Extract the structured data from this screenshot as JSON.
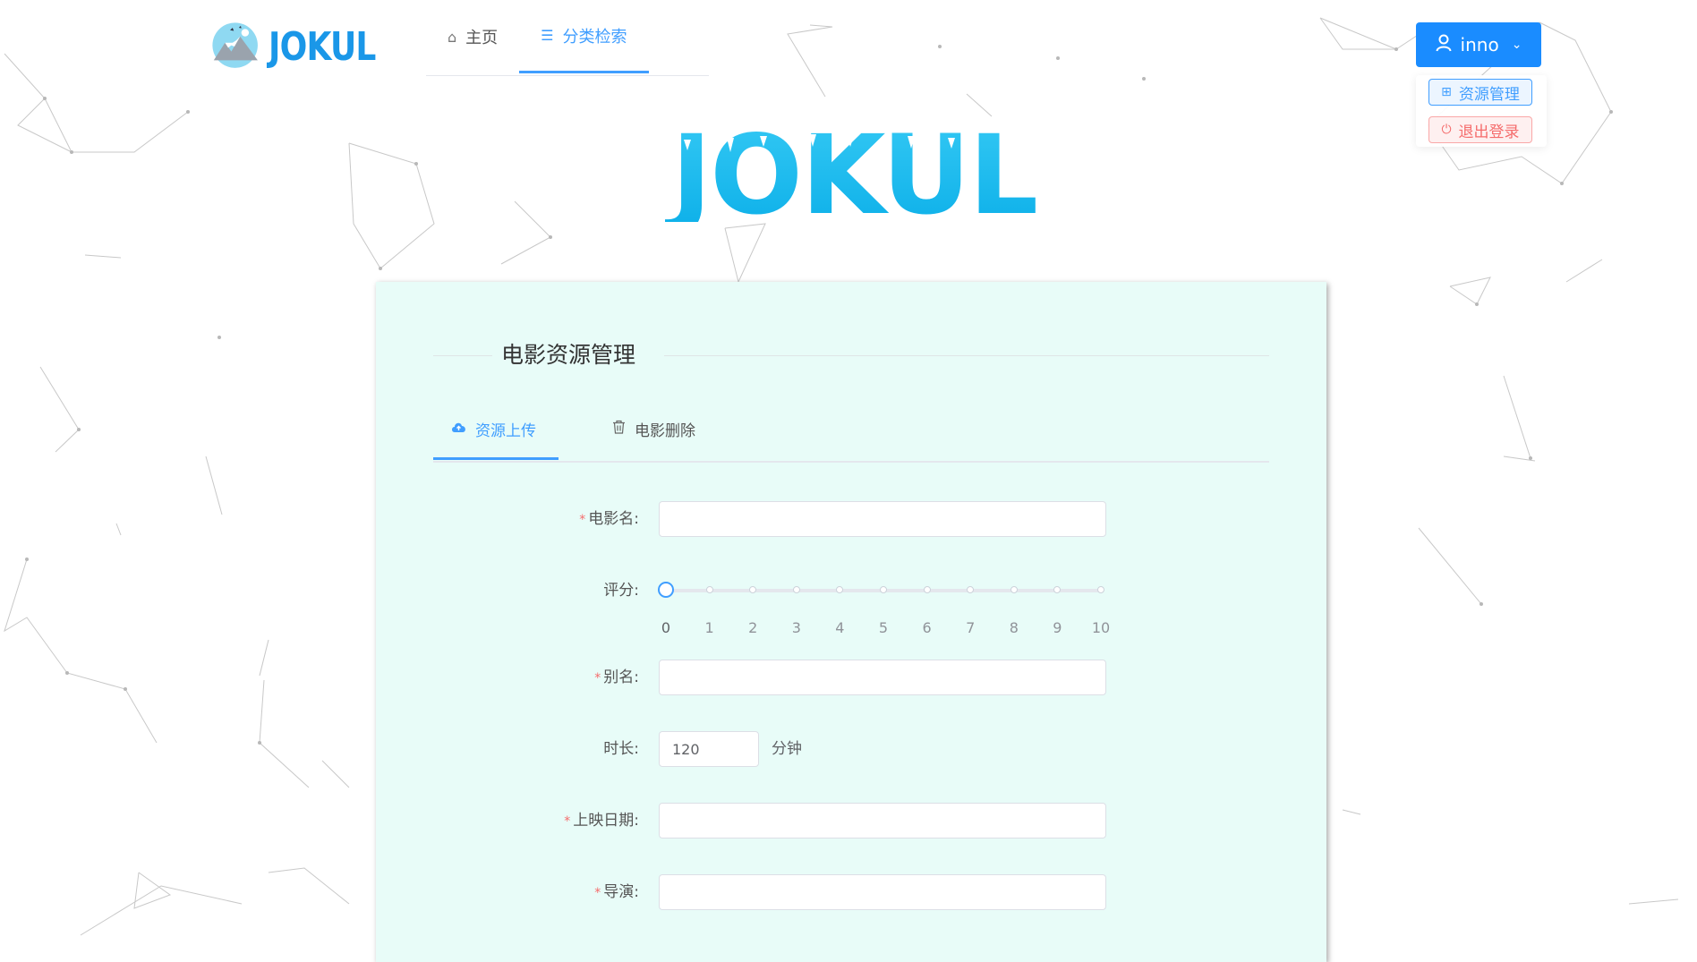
{
  "brand": {
    "logo_text": "JOKUL",
    "hero_text": "JOKUL",
    "accent": "#409eff",
    "logo_blue": "#1a97e8",
    "hero_blue": "#12b8ee"
  },
  "nav": {
    "items": [
      {
        "label": "主页",
        "icon": "home-icon",
        "active": false
      },
      {
        "label": "分类检索",
        "icon": "list-icon",
        "active": true
      }
    ]
  },
  "user": {
    "name": "inno",
    "icon": "user-icon",
    "menu": {
      "manage_label": "资源管理",
      "manage_icon": "grid-icon",
      "logout_label": "退出登录",
      "logout_icon": "logout-icon"
    }
  },
  "card": {
    "title": "电影资源管理",
    "background": "#e8fcf8",
    "tabs": [
      {
        "label": "资源上传",
        "icon": "upload-cloud-icon",
        "active": true
      },
      {
        "label": "电影删除",
        "icon": "trash-icon",
        "active": false
      }
    ],
    "form": {
      "name_label": "电影名:",
      "name_value": "",
      "rating_label": "评分:",
      "rating_value": 0,
      "rating_min": 0,
      "rating_max": 10,
      "rating_ticks": [
        "0",
        "1",
        "2",
        "3",
        "4",
        "5",
        "6",
        "7",
        "8",
        "9",
        "10"
      ],
      "alias_label": "别名:",
      "alias_value": "",
      "duration_label": "时长:",
      "duration_value": "120",
      "duration_unit": "分钟",
      "release_label": "上映日期:",
      "release_value": "",
      "director_label": "导演:",
      "director_value": "",
      "required_mark": "*"
    }
  }
}
